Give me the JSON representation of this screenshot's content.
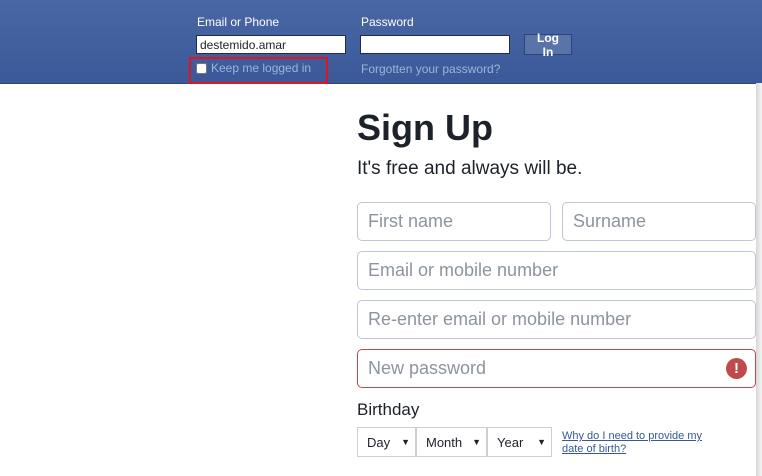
{
  "login": {
    "email_label": "Email or Phone",
    "email_value": "destemido.amar",
    "password_label": "Password",
    "password_value": "",
    "login_button": "Log In",
    "keep_logged_in": "Keep me logged in",
    "keep_logged_in_checked": false,
    "forgot_password": "Forgotten your password?"
  },
  "signup": {
    "title": "Sign Up",
    "subtitle": "It's free and always will be.",
    "first_name_placeholder": "First name",
    "surname_placeholder": "Surname",
    "email_placeholder": "Email or mobile number",
    "reenter_email_placeholder": "Re-enter email or mobile number",
    "new_password_placeholder": "New password",
    "error_icon": "!",
    "birthday_label": "Birthday",
    "day_label": "Day",
    "month_label": "Month",
    "year_label": "Year",
    "why_dob": "Why do I need to provide my date of birth?"
  },
  "colors": {
    "header_blue": "#3b5998",
    "error_red": "#be4b49",
    "highlight_red": "#e0141e"
  },
  "icons": {
    "dropdown": "chevron-down-icon",
    "error": "exclamation-circle-icon"
  }
}
